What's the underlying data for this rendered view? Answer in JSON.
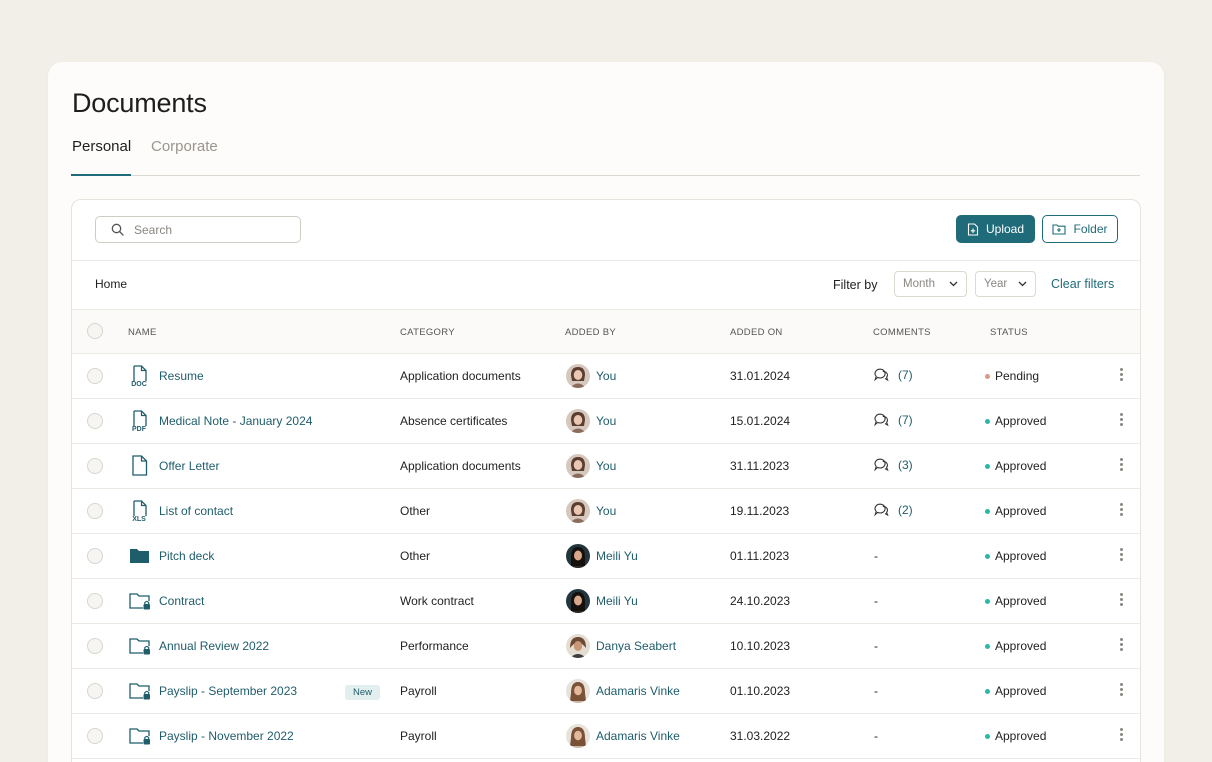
{
  "page": {
    "title": "Documents"
  },
  "tabs": [
    {
      "label": "Personal",
      "active": true
    },
    {
      "label": "Corporate",
      "active": false
    }
  ],
  "toolbar": {
    "search_placeholder": "Search",
    "upload_label": "Upload",
    "folder_label": "Folder"
  },
  "filters": {
    "breadcrumb": "Home",
    "filter_by_label": "Filter by",
    "month_placeholder": "Month",
    "year_placeholder": "Year",
    "clear_label": "Clear filters"
  },
  "table": {
    "columns": [
      "NAME",
      "CATEGORY",
      "ADDED BY",
      "ADDED ON",
      "COMMENTS",
      "STATUS"
    ],
    "rows": [
      {
        "name": "Resume",
        "file_type": "DOC",
        "icon": "doc-file-icon",
        "badge": "",
        "category": "Application documents",
        "added_by": "You",
        "avatar": "you-avatar",
        "added_on": "31.01.2024",
        "comments": "(7)",
        "status": "Pending"
      },
      {
        "name": "Medical Note - January 2024",
        "file_type": "PDF",
        "icon": "pdf-file-icon",
        "badge": "",
        "category": "Absence certificates",
        "added_by": "You",
        "avatar": "you-avatar",
        "added_on": "15.01.2024",
        "comments": "(7)",
        "status": "Approved"
      },
      {
        "name": "Offer Letter",
        "file_type": "",
        "icon": "file-icon",
        "badge": "",
        "category": "Application documents",
        "added_by": "You",
        "avatar": "you-avatar",
        "added_on": "31.11.2023",
        "comments": "(3)",
        "status": "Approved"
      },
      {
        "name": "List of contact",
        "file_type": "XLS",
        "icon": "xls-file-icon",
        "badge": "",
        "category": "Other",
        "added_by": "You",
        "avatar": "you-avatar",
        "added_on": "19.11.2023",
        "comments": "(2)",
        "status": "Approved"
      },
      {
        "name": "Pitch deck",
        "file_type": "",
        "icon": "folder-icon",
        "badge": "",
        "category": "Other",
        "added_by": "Meili Yu",
        "avatar": "meili-avatar",
        "added_on": "01.11.2023",
        "comments": "-",
        "status": "Approved"
      },
      {
        "name": "Contract",
        "file_type": "",
        "icon": "locked-folder-icon",
        "badge": "",
        "category": "Work contract",
        "added_by": "Meili Yu",
        "avatar": "meili-avatar",
        "added_on": "24.10.2023",
        "comments": "-",
        "status": "Approved"
      },
      {
        "name": "Annual Review 2022",
        "file_type": "",
        "icon": "locked-folder-icon",
        "badge": "",
        "category": "Performance",
        "added_by": "Danya Seabert",
        "avatar": "danya-avatar",
        "added_on": "10.10.2023",
        "comments": "-",
        "status": "Approved"
      },
      {
        "name": "Payslip - September 2023",
        "file_type": "",
        "icon": "locked-folder-icon",
        "badge": "New",
        "category": "Payroll",
        "added_by": "Adamaris Vinke",
        "avatar": "adamaris-avatar",
        "added_on": "01.10.2023",
        "comments": "-",
        "status": "Approved"
      },
      {
        "name": "Payslip - November 2022",
        "file_type": "",
        "icon": "locked-folder-icon",
        "badge": "",
        "category": "Payroll",
        "added_by": "Adamaris Vinke",
        "avatar": "adamaris-avatar",
        "added_on": "31.03.2022",
        "comments": "-",
        "status": "Approved"
      }
    ]
  },
  "colors": {
    "accent": "#1f6b7a",
    "link": "#1f5d6b",
    "approved": "#2ab7a9",
    "pending": "#d79a86",
    "background": "#f1efe8"
  }
}
